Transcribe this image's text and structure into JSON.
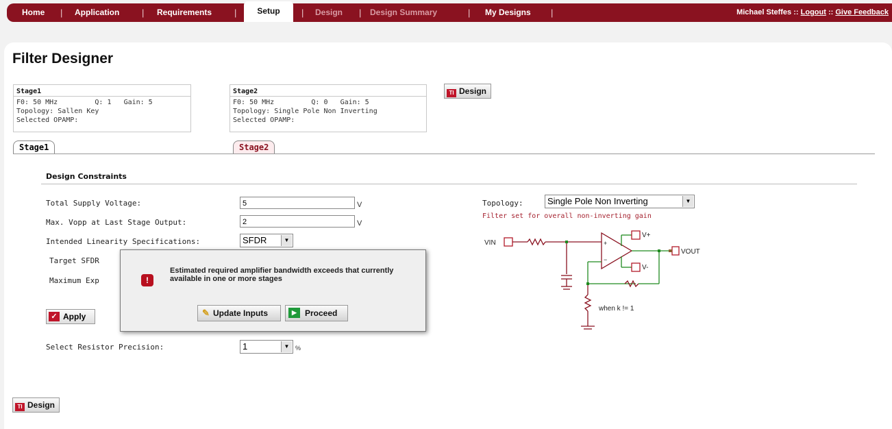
{
  "nav": {
    "items": [
      {
        "label": "Home"
      },
      {
        "label": "Application"
      },
      {
        "label": "Requirements"
      },
      {
        "label": "Setup"
      },
      {
        "label": "Design"
      },
      {
        "label": "Design Summary"
      },
      {
        "label": "My Designs"
      }
    ],
    "user": "Michael Steffes",
    "sep": "::",
    "logout": "Logout",
    "feedback": "Give Feedback"
  },
  "page": {
    "title": "Filter Designer"
  },
  "stages": [
    {
      "name": "Stage1",
      "f0": "F0: 50 MHz",
      "q": "Q: 1",
      "gain": "Gain: 5",
      "topology": "Topology: Sallen Key",
      "opamp": "Selected OPAMP:"
    },
    {
      "name": "Stage2",
      "f0": "F0: 50 MHz",
      "q": "Q: 0",
      "gain": "Gain: 5",
      "topology": "Topology: Single Pole Non Inverting",
      "opamp": "Selected OPAMP:"
    }
  ],
  "design_button": "Design",
  "ti_logo": "TI",
  "tabs": [
    "Stage1",
    "Stage2"
  ],
  "constraints": {
    "section_title": "Design Constraints",
    "supply_label": "Total Supply Voltage:",
    "supply_value": "5",
    "supply_unit": "V",
    "vopp_label": "Max. Vopp at Last Stage Output:",
    "vopp_value": "2",
    "vopp_unit": "V",
    "linearity_label": "Intended Linearity Specifications:",
    "linearity_value": "SFDR",
    "target_label": "Target SFDR",
    "max_label": "Maximum Exp",
    "apply_label": "Apply",
    "precision_label": "Select Resistor Precision:",
    "precision_value": "1",
    "precision_unit": "%",
    "topology_label": "Topology:",
    "topology_value": "Single Pole Non Inverting",
    "topology_hint": "Filter set for overall non-inverting gain"
  },
  "schematic": {
    "vin": "VIN",
    "vout": "VOUT",
    "vplus": "V+",
    "vminus": "V-",
    "note": "when k != 1",
    "plus": "+",
    "minus": "−"
  },
  "modal": {
    "message": "Estimated required amplifier bandwidth exceeds that currently available in one or more stages",
    "update_label": "Update Inputs",
    "proceed_label": "Proceed"
  },
  "colors": {
    "brand": "#8a1220",
    "accent": "#c0152a",
    "hint": "#a5222f",
    "wire": "#1f8a1f"
  }
}
